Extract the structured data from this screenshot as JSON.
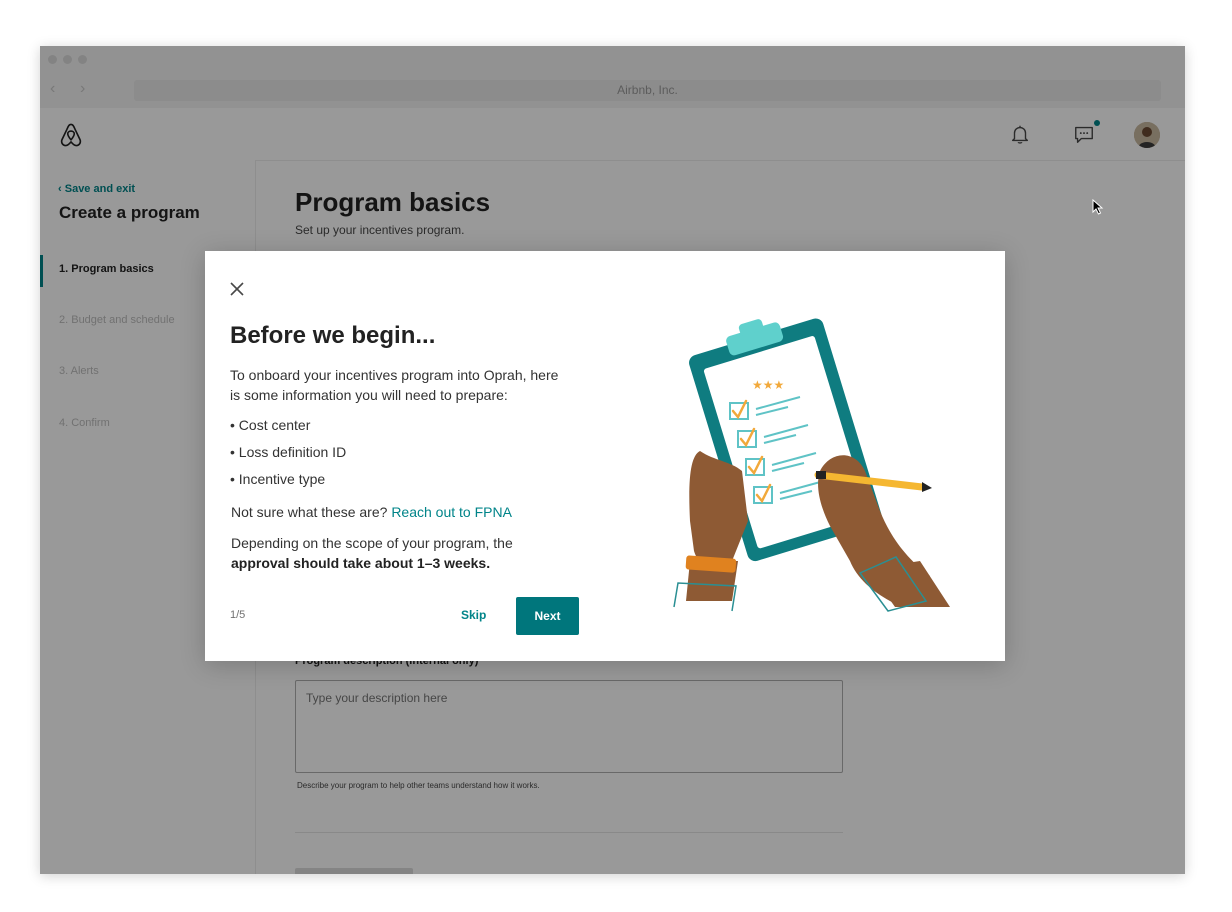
{
  "browser": {
    "url_title": "Airbnb, Inc."
  },
  "sidebar": {
    "back_link": "Save and exit",
    "title": "Create a program",
    "steps": [
      {
        "label": "1. Program basics",
        "active": true
      },
      {
        "label": "2. Budget and schedule",
        "active": false
      },
      {
        "label": "3. Alerts",
        "active": false
      },
      {
        "label": "4. Confirm",
        "active": false
      }
    ]
  },
  "main": {
    "title": "Program basics",
    "subtitle": "Set up your incentives program.",
    "description_label": "Program description (internal only)",
    "description_placeholder": "Type your description here",
    "description_helper": "Describe your program to help other teams understand how it works."
  },
  "modal": {
    "title": "Before we begin...",
    "intro": "To onboard your incentives program into Oprah, here is some information you will need to prepare:",
    "bullets": [
      "• Cost center",
      "• Loss definition ID",
      "• Incentive type"
    ],
    "not_sure_text": "Not sure what these are?",
    "not_sure_link": "Reach out to FPNA",
    "depend_text": "Depending on the scope of your program, the",
    "depend_bold": "approval should take about 1–3 weeks.",
    "counter": "1/5",
    "skip_label": "Skip",
    "next_label": "Next"
  },
  "colors": {
    "accent": "#008489",
    "primary_button": "#00767c",
    "overlay": "rgba(0,0,0,0.40)"
  },
  "icons": [
    "airbnb-logo-icon",
    "bell-icon",
    "message-icon",
    "close-icon",
    "chevron-left-icon",
    "cursor-icon"
  ]
}
